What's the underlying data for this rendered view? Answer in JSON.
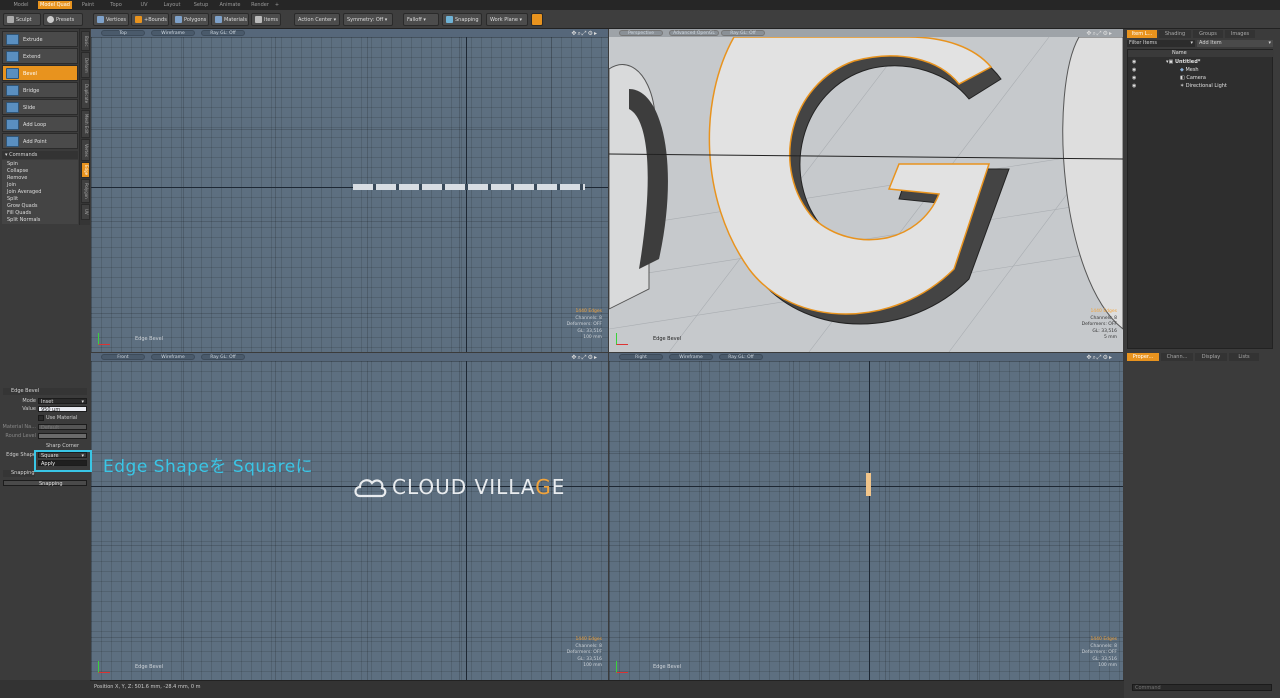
{
  "tabs": [
    "Model",
    "Model Quad",
    "Paint",
    "Topo",
    "UV",
    "Layout",
    "Setup",
    "Animate",
    "Render",
    "+"
  ],
  "toolbar": {
    "sculpt": "Sculpt",
    "presets": "Presets",
    "vertices": "Vertices",
    "bounds": "+Bounds",
    "polygons": "Polygons",
    "materials": "Materials",
    "items": "Items",
    "action_center": "Action Center",
    "symmetry": "Symmetry: Off",
    "falloff": "Falloff",
    "snapping": "Snapping",
    "work_plane": "Work Plane"
  },
  "tools": [
    "Extrude",
    "Extend",
    "Bevel",
    "Bridge",
    "Slide",
    "Add Loop",
    "Add Point"
  ],
  "commands_header": "Commands",
  "commands": [
    "Spin",
    "Collapse",
    "Remove",
    "Join",
    "Join Averaged",
    "Split",
    "Grow Quads",
    "Fill Quads",
    "Split Normals"
  ],
  "vtabs": [
    "Basic",
    "Deform",
    "Duplicate",
    "Mesh Edit",
    "Vertex",
    "Edge",
    "Polygon",
    "UV"
  ],
  "props": {
    "header": "Edge Bevel",
    "mode_label": "Mode",
    "mode_value": "Inset",
    "value_label": "Value",
    "value_value": "950 µm",
    "use_material": "Use Material",
    "material_label": "Material Na...",
    "material_value": "Default",
    "round_label": "Round Level",
    "sharp_corner": "Sharp Corner",
    "edge_shape_label": "Edge Shape",
    "edge_shape_value": "Square",
    "apply": "Apply",
    "snapping_header": "Snapping",
    "snapping_row": "Snapping"
  },
  "callout": "Edge Shapeを Squareに",
  "watermark": {
    "text_main": "CLOUD VILLA",
    "text_g": "G",
    "text_end": "E"
  },
  "viewports": [
    {
      "view": "Top",
      "mode": "Wireframe",
      "ray": "Ray GL: Off",
      "label": "Edge Bevel",
      "stats": [
        "1440 Edges",
        "Channels: 8",
        "Deformers: OFF",
        "GL: 33,516",
        "100 mm"
      ]
    },
    {
      "view": "Perspective",
      "mode": "Advanced OpenGL",
      "ray": "Ray GL: Off",
      "label": "Edge Bevel",
      "stats": [
        "1440 Edges",
        "Channels: 8",
        "Deformers: OFF",
        "GL: 33,516",
        "5 mm"
      ]
    },
    {
      "view": "Front",
      "mode": "Wireframe",
      "ray": "Ray GL: Off",
      "label": "Edge Bevel",
      "stats": [
        "1440 Edges",
        "Channels: 8",
        "Deformers: OFF",
        "GL: 33,516",
        "100 mm"
      ]
    },
    {
      "view": "Right",
      "mode": "Wireframe",
      "ray": "Ray GL: Off",
      "label": "Edge Bevel",
      "stats": [
        "1440 Edges",
        "Channels: 8",
        "Deformers: OFF",
        "GL: 33,516",
        "100 mm"
      ]
    }
  ],
  "items_panel": {
    "tabs": [
      "Item L...",
      "Shading",
      "Groups",
      "Images"
    ],
    "filter": "Filter Items",
    "add_item": "Add Item",
    "col_name": "Name",
    "tree": [
      "Untitled*",
      "Mesh",
      "Camera",
      "Directional Light"
    ]
  },
  "props_panel": {
    "tabs": [
      "Proper...",
      "Chann...",
      "Display",
      "Lists"
    ],
    "command_placeholder": "Command"
  },
  "status": "Position X, Y, Z:  501.6 mm, -28.4 mm, 0 m"
}
